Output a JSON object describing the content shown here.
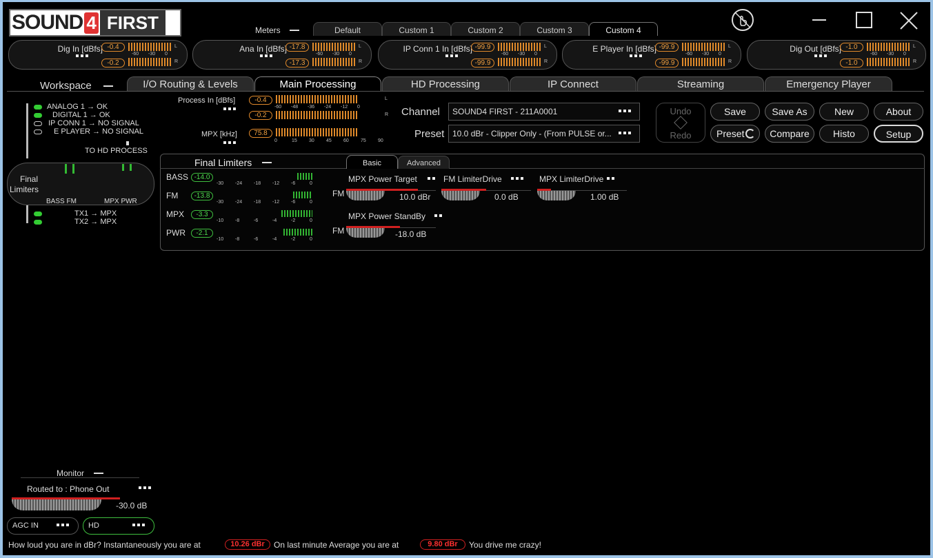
{
  "logo": {
    "part1": "SOUND",
    "part2": "4",
    "part3": "FIRST"
  },
  "window": {
    "minimize_icon": "minimize-icon",
    "maximize_icon": "maximize-icon",
    "close_icon": "close-icon"
  },
  "meters_label": "Meters",
  "meter_tabs": [
    "Default",
    "Custom 1",
    "Custom 2",
    "Custom 3",
    "Custom 4"
  ],
  "meter_pills": [
    {
      "label": "Dig In [dBfs]",
      "l": "-0.4",
      "r": "-0.2"
    },
    {
      "label": "Ana In [dBfs]",
      "l": "-17.8",
      "r": "-17.3"
    },
    {
      "label": "IP Conn 1 In [dBfs]",
      "l": "-99.9",
      "r": "-99.9"
    },
    {
      "label": "E Player In [dBfs]",
      "l": "-99.9",
      "r": "-99.9"
    },
    {
      "label": "Dig Out [dBfs]",
      "l": "-1.0",
      "r": "-1.0"
    }
  ],
  "meter_scale": [
    "-60",
    "-30",
    "0"
  ],
  "workspace_label": "Workspace",
  "workspace_tabs": [
    "I/O Routing & Levels",
    "Main Processing",
    "HD Processing",
    "IP Connect",
    "Streaming",
    "Emergency Player"
  ],
  "inputs": [
    {
      "name": "ANALOG 1",
      "status": "OK"
    },
    {
      "name": "DIGITAL 1",
      "status": "OK"
    },
    {
      "name": "IP CONN 1",
      "status": "NO SIGNAL"
    },
    {
      "name": "E PLAYER",
      "status": "NO SIGNAL"
    }
  ],
  "to_hd_process": "TO HD PROCESS",
  "final_limiters_node": {
    "label1": "Final",
    "label2": "Limiters",
    "sub1": "BASS FM",
    "sub2": "MPX PWR"
  },
  "outputs": [
    {
      "name": "TX1",
      "dest": "MPX"
    },
    {
      "name": "TX2",
      "dest": "MPX"
    }
  ],
  "process_in": {
    "label": "Process In [dBfs]",
    "l": "-0.4",
    "r": "-0.2",
    "scale": [
      "-60",
      "-48",
      "-36",
      "-24",
      "-12",
      "0"
    ]
  },
  "mpx": {
    "label": "MPX [kHz]",
    "value": "75.8",
    "scale": [
      "0",
      "15",
      "30",
      "45",
      "60",
      "75",
      "90"
    ]
  },
  "channel": {
    "label": "Channel",
    "value": "SOUND4 FIRST - 211A0001"
  },
  "preset": {
    "label": "Preset",
    "value": "10.0 dBr -  Clipper Only - (From PULSE or..."
  },
  "buttons": {
    "undo": "Undo",
    "redo": "Redo",
    "save": "Save",
    "save_as": "Save As",
    "new": "New",
    "about": "About",
    "preset": "Preset",
    "compare": "Compare",
    "histo": "Histo",
    "setup": "Setup"
  },
  "final_limiters": {
    "title": "Final Limiters",
    "tabs": [
      "Basic",
      "Advanced"
    ],
    "rows": [
      {
        "label": "BASS",
        "value": "-14.0",
        "scale": [
          "-30",
          "-24",
          "-18",
          "-12",
          "-6",
          "0"
        ]
      },
      {
        "label": "FM",
        "value": "-13.8",
        "scale": [
          "-30",
          "-24",
          "-18",
          "-12",
          "-6",
          "0"
        ]
      },
      {
        "label": "MPX",
        "value": "-3.3",
        "scale": [
          "-10",
          "-8",
          "-6",
          "-4",
          "-2",
          "0"
        ]
      },
      {
        "label": "PWR",
        "value": "-2.1",
        "scale": [
          "-10",
          "-8",
          "-6",
          "-4",
          "-2",
          "0"
        ]
      }
    ],
    "fm_label": "FM",
    "controls": [
      {
        "label": "MPX Power Target",
        "value": "10.0 dBr",
        "fill": 0.8
      },
      {
        "label": "FM LimiterDrive",
        "value": "0.0 dB",
        "fill": 0.5
      },
      {
        "label": "MPX LimiterDrive",
        "value": "1.00 dB",
        "fill": 0.15
      },
      {
        "label": "MPX Power StandBy",
        "value": "-18.0 dB",
        "fill": 0.6
      }
    ]
  },
  "monitor": {
    "label": "Monitor",
    "routed": "Routed to : Phone Out",
    "value": "-30.0 dB"
  },
  "agc_in": "AGC IN",
  "hd": "HD",
  "status_bar": {
    "q": "How loud you are in dBr? Instantaneously you are at",
    "inst": "10.26 dBr",
    "mid": "On last minute Average you are at",
    "avg": "9.80 dBr",
    "end": "You drive me crazy!"
  }
}
